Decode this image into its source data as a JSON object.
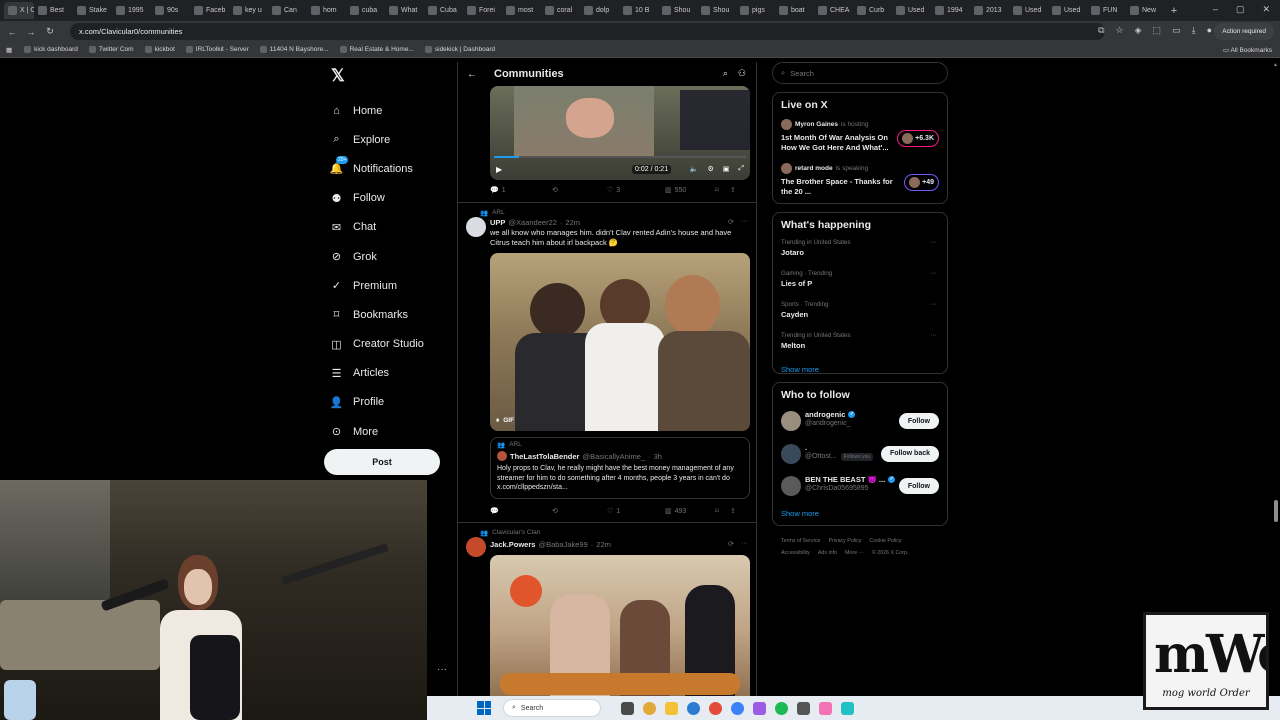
{
  "browser": {
    "tabs": [
      {
        "label": "X | C",
        "icon": "x-logo-icon"
      },
      {
        "label": "Best",
        "icon": "globe-icon"
      },
      {
        "label": "Stake",
        "icon": "dollar-icon"
      },
      {
        "label": "1995",
        "icon": "globe-icon"
      },
      {
        "label": "90s",
        "icon": "globe-icon"
      },
      {
        "label": "Faceb",
        "icon": "facebook-icon"
      },
      {
        "label": "key u",
        "icon": "globe-icon"
      },
      {
        "label": "Can",
        "icon": "globe-icon"
      },
      {
        "label": "hom",
        "icon": "globe-icon"
      },
      {
        "label": "cuba",
        "icon": "globe-icon"
      },
      {
        "label": "What",
        "icon": "globe-icon"
      },
      {
        "label": "Cuba",
        "icon": "globe-icon"
      },
      {
        "label": "Forei",
        "icon": "globe-icon"
      },
      {
        "label": "most",
        "icon": "globe-icon"
      },
      {
        "label": "coral",
        "icon": "globe-icon"
      },
      {
        "label": "dolp",
        "icon": "globe-icon"
      },
      {
        "label": "10 B",
        "icon": "globe-icon"
      },
      {
        "label": "Shou",
        "icon": "globe-icon"
      },
      {
        "label": "Shou",
        "icon": "globe-icon"
      },
      {
        "label": "pigs",
        "icon": "globe-icon"
      },
      {
        "label": "boat",
        "icon": "globe-icon"
      },
      {
        "label": "CHEA",
        "icon": "globe-icon"
      },
      {
        "label": "Curb",
        "icon": "globe-icon"
      },
      {
        "label": "Used",
        "icon": "globe-icon"
      },
      {
        "label": "1994",
        "icon": "globe-icon"
      },
      {
        "label": "2013",
        "icon": "globe-icon"
      },
      {
        "label": "Used",
        "icon": "globe-icon"
      },
      {
        "label": "Used",
        "icon": "globe-icon"
      },
      {
        "label": "FUN",
        "icon": "globe-icon"
      },
      {
        "label": "New",
        "icon": "globe-icon"
      }
    ],
    "url": "x.com/Clavicular0/communities",
    "action_required": "Action required",
    "all_bookmarks": "All Bookmarks",
    "bookmarks": [
      {
        "label": "kick dashboard"
      },
      {
        "label": "Twitter Com"
      },
      {
        "label": "kickbot"
      },
      {
        "label": "IRLToolkit - Server"
      },
      {
        "label": "11404 N Bayshore..."
      },
      {
        "label": "Real Estate & Home..."
      },
      {
        "label": "sidekick | Dashboard"
      }
    ]
  },
  "sidebar": {
    "nav": [
      {
        "label": "Home",
        "icon": "home-icon"
      },
      {
        "label": "Explore",
        "icon": "search-icon"
      },
      {
        "label": "Notifications",
        "icon": "bell-icon",
        "badge": "20+"
      },
      {
        "label": "Follow",
        "icon": "person-add-icon"
      },
      {
        "label": "Chat",
        "icon": "mail-icon"
      },
      {
        "label": "Grok",
        "icon": "grok-icon"
      },
      {
        "label": "Premium",
        "icon": "premium-icon"
      },
      {
        "label": "Bookmarks",
        "icon": "bookmark-icon"
      },
      {
        "label": "Creator Studio",
        "icon": "creator-studio-icon"
      },
      {
        "label": "Articles",
        "icon": "articles-icon"
      },
      {
        "label": "Profile",
        "icon": "profile-icon"
      },
      {
        "label": "More",
        "icon": "more-icon"
      }
    ],
    "post_label": "Post"
  },
  "feed": {
    "title": "Communities",
    "video": {
      "time": "0:02 / 0:21",
      "progress": 0.1
    },
    "post1_actions": {
      "replies": "1",
      "retweets": "",
      "likes": "3",
      "views": "550"
    },
    "post2": {
      "community": "ARL",
      "name": "UPP",
      "handle": "@Xaandeer22",
      "time": "22m",
      "text": "we all know who manages him. didn't Clav rented Adin's house and have Citrus teach him about irl backpack 🤔",
      "gif_label": "GIF",
      "quote": {
        "community": "ARL",
        "name": "TheLastTolaBender",
        "handle": "@BasicallyAnime_",
        "time": "3h",
        "text": "Holy props to Clav, he really might have the best money management of any streamer for him to do something after 4 months, people 3 years in can't do x.com/cllppedszn/sta..."
      },
      "actions": {
        "replies": "",
        "retweets": "",
        "likes": "1",
        "views": "493"
      }
    },
    "post3": {
      "community": "Clavicular's Clan",
      "name": "Jack.Powers",
      "handle": "@BabaJake99",
      "time": "22m"
    }
  },
  "right": {
    "search_placeholder": "Search",
    "live": {
      "title": "Live on X",
      "items": [
        {
          "host": "Myron Gaines",
          "status": "is hosting",
          "title": "1st Month Of War Analysis On How We Got Here And What'...",
          "count": "+6.3K"
        },
        {
          "host": "retard mode",
          "status": "is speaking",
          "title": "The Brother Space - Thanks for the 20 ...",
          "count": "+49"
        }
      ]
    },
    "happening": {
      "title": "What's happening",
      "trends": [
        {
          "meta": "Trending in United States",
          "name": "Jotaro"
        },
        {
          "meta": "Gaming · Trending",
          "name": "Lies of P"
        },
        {
          "meta": "Sports · Trending",
          "name": "Cayden"
        },
        {
          "meta": "Trending in United States",
          "name": "Melton"
        }
      ],
      "show_more": "Show more"
    },
    "who_to_follow": {
      "title": "Who to follow",
      "accounts": [
        {
          "name": "androgenic",
          "handle": "@androgenic_",
          "button": "Follow",
          "follows_you": ""
        },
        {
          "name": ".",
          "handle": "@Ottost...",
          "button": "Follow back",
          "follows_you": "Follows you"
        },
        {
          "name": "BEN THE BEAST 😈 ...",
          "handle": "@ChrisDa05695895",
          "button": "Follow",
          "follows_you": ""
        }
      ],
      "show_more": "Show more"
    },
    "footer": [
      "Terms of Service",
      "Privacy Policy",
      "Cookie Policy",
      "Accessibility",
      "Ads info",
      "More ···",
      "© 2026 X Corp."
    ]
  },
  "taskbar": {
    "search_label": "Search"
  },
  "overlay": {
    "logo_big": "mWo",
    "logo_small": "mog world Order"
  },
  "colors": {
    "accent": "#1d9bf0",
    "live_pink": "#f91880",
    "live_purple": "#7856ff",
    "background": "#000000"
  }
}
